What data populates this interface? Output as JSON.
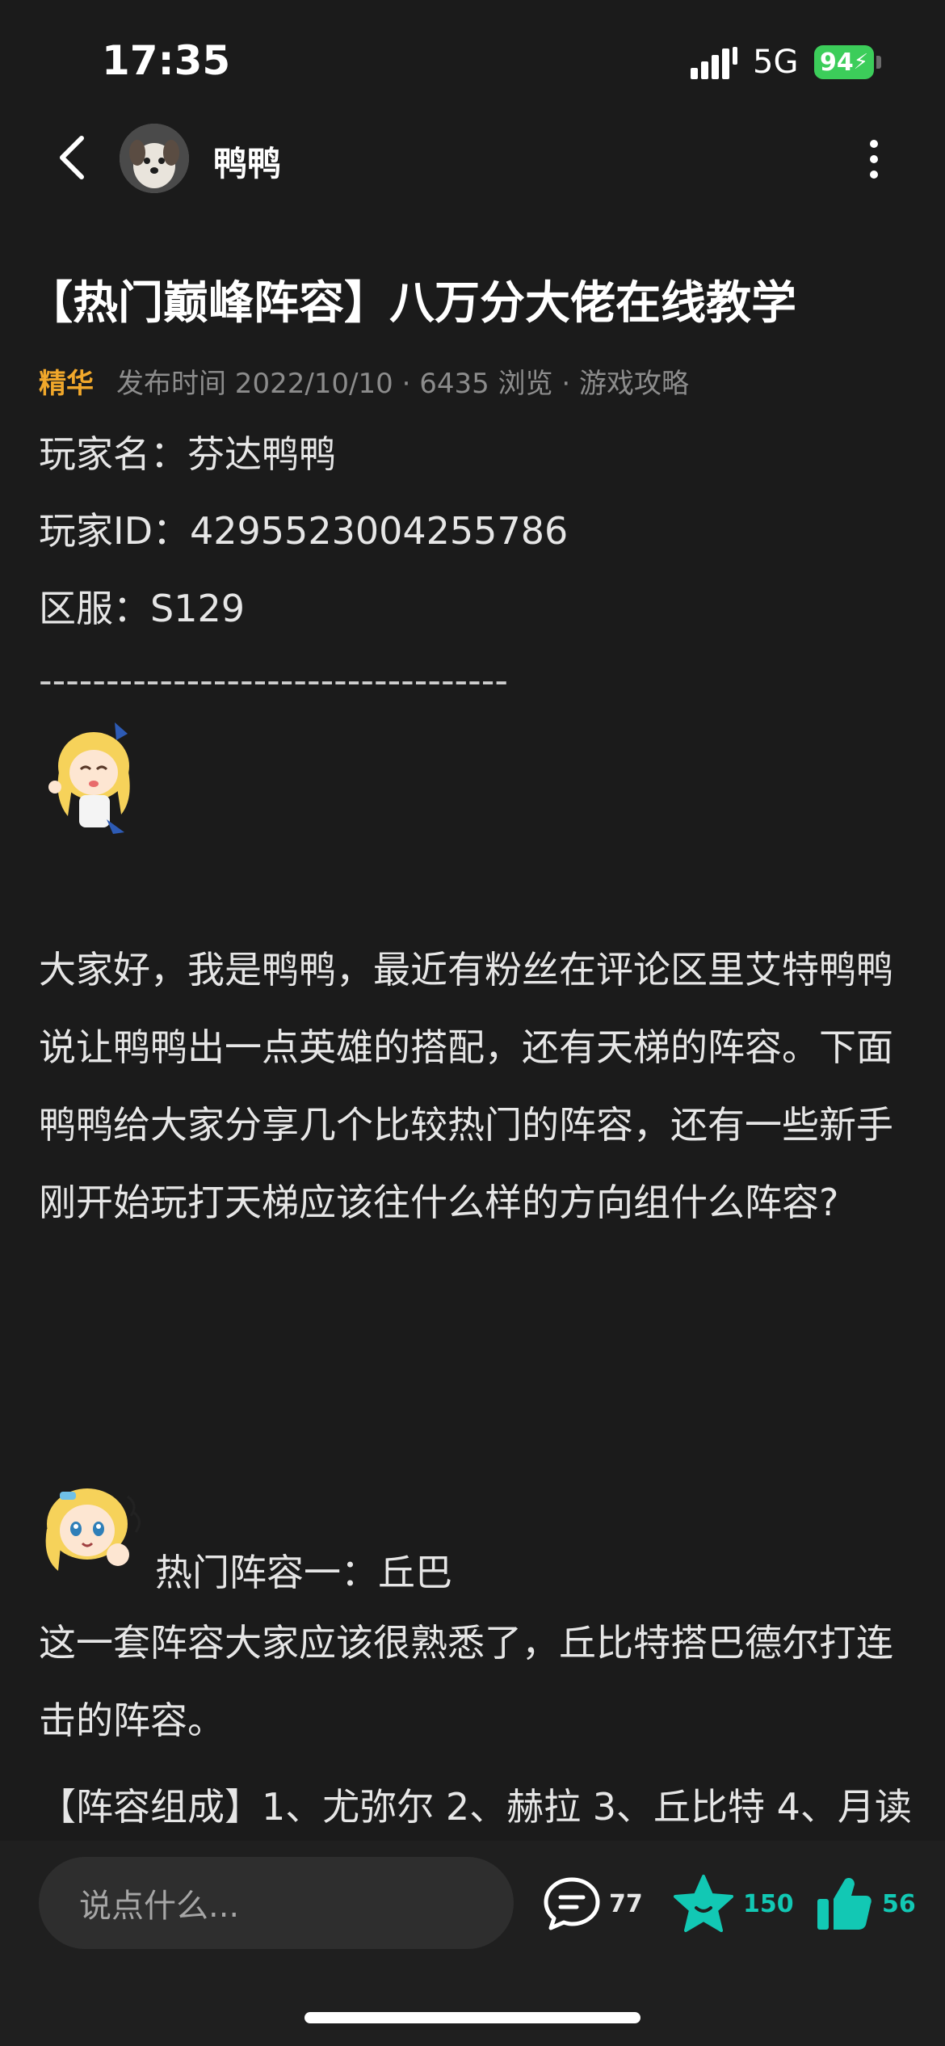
{
  "status_bar": {
    "time": "17:35",
    "network": "5G",
    "battery": "94"
  },
  "nav": {
    "author_name": "鸭鸭"
  },
  "article": {
    "title": "【热门巅峰阵容】八万分大佬在线教学",
    "badge": "精华",
    "meta": "发布时间 2022/10/10 · 6435 浏览 · 游戏攻略",
    "player_name_line": "玩家名：芬达鸭鸭",
    "player_id_line": "玩家ID：4295523004255786",
    "server_line": "区服：S129",
    "divider": "-----------------------------------",
    "intro": "大家好，我是鸭鸭，最近有粉丝在评论区里艾特鸭鸭说让鸭鸭出一点英雄的搭配，还有天梯的阵容。下面鸭鸭给大家分享几个比较热门的阵容，还有一些新手刚开始玩打天梯应该往什么样的方向组什么阵容?",
    "section1_heading": "热门阵容一：丘巴",
    "section1_desc": "这一套阵容大家应该很熟悉了，丘比特搭巴德尔打连击的阵容。",
    "section1_comp": "【阵容组成】1、尤弥尔 2、赫拉 3、丘比特 4、月读"
  },
  "bottom_bar": {
    "input_placeholder": "说点什么...",
    "comment_count": "77",
    "favorite_count": "150",
    "like_count": "56"
  },
  "colors": {
    "background": "#1b1b1b",
    "badge": "#f1a82b",
    "teal_accent": "#12c8b4",
    "battery": "#3ccd5a"
  },
  "icons": [
    "back-arrow-icon",
    "more-vertical-icon",
    "comment-icon",
    "star-icon",
    "thumbs-up-icon"
  ]
}
